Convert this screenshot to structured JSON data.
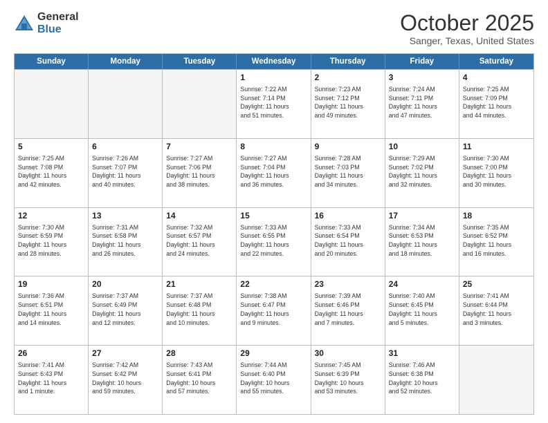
{
  "logo": {
    "general": "General",
    "blue": "Blue"
  },
  "header": {
    "month": "October 2025",
    "location": "Sanger, Texas, United States"
  },
  "days_of_week": [
    "Sunday",
    "Monday",
    "Tuesday",
    "Wednesday",
    "Thursday",
    "Friday",
    "Saturday"
  ],
  "weeks": [
    [
      {
        "day": "",
        "info": ""
      },
      {
        "day": "",
        "info": ""
      },
      {
        "day": "",
        "info": ""
      },
      {
        "day": "1",
        "info": "Sunrise: 7:22 AM\nSunset: 7:14 PM\nDaylight: 11 hours\nand 51 minutes."
      },
      {
        "day": "2",
        "info": "Sunrise: 7:23 AM\nSunset: 7:12 PM\nDaylight: 11 hours\nand 49 minutes."
      },
      {
        "day": "3",
        "info": "Sunrise: 7:24 AM\nSunset: 7:11 PM\nDaylight: 11 hours\nand 47 minutes."
      },
      {
        "day": "4",
        "info": "Sunrise: 7:25 AM\nSunset: 7:09 PM\nDaylight: 11 hours\nand 44 minutes."
      }
    ],
    [
      {
        "day": "5",
        "info": "Sunrise: 7:25 AM\nSunset: 7:08 PM\nDaylight: 11 hours\nand 42 minutes."
      },
      {
        "day": "6",
        "info": "Sunrise: 7:26 AM\nSunset: 7:07 PM\nDaylight: 11 hours\nand 40 minutes."
      },
      {
        "day": "7",
        "info": "Sunrise: 7:27 AM\nSunset: 7:06 PM\nDaylight: 11 hours\nand 38 minutes."
      },
      {
        "day": "8",
        "info": "Sunrise: 7:27 AM\nSunset: 7:04 PM\nDaylight: 11 hours\nand 36 minutes."
      },
      {
        "day": "9",
        "info": "Sunrise: 7:28 AM\nSunset: 7:03 PM\nDaylight: 11 hours\nand 34 minutes."
      },
      {
        "day": "10",
        "info": "Sunrise: 7:29 AM\nSunset: 7:02 PM\nDaylight: 11 hours\nand 32 minutes."
      },
      {
        "day": "11",
        "info": "Sunrise: 7:30 AM\nSunset: 7:00 PM\nDaylight: 11 hours\nand 30 minutes."
      }
    ],
    [
      {
        "day": "12",
        "info": "Sunrise: 7:30 AM\nSunset: 6:59 PM\nDaylight: 11 hours\nand 28 minutes."
      },
      {
        "day": "13",
        "info": "Sunrise: 7:31 AM\nSunset: 6:58 PM\nDaylight: 11 hours\nand 26 minutes."
      },
      {
        "day": "14",
        "info": "Sunrise: 7:32 AM\nSunset: 6:57 PM\nDaylight: 11 hours\nand 24 minutes."
      },
      {
        "day": "15",
        "info": "Sunrise: 7:33 AM\nSunset: 6:55 PM\nDaylight: 11 hours\nand 22 minutes."
      },
      {
        "day": "16",
        "info": "Sunrise: 7:33 AM\nSunset: 6:54 PM\nDaylight: 11 hours\nand 20 minutes."
      },
      {
        "day": "17",
        "info": "Sunrise: 7:34 AM\nSunset: 6:53 PM\nDaylight: 11 hours\nand 18 minutes."
      },
      {
        "day": "18",
        "info": "Sunrise: 7:35 AM\nSunset: 6:52 PM\nDaylight: 11 hours\nand 16 minutes."
      }
    ],
    [
      {
        "day": "19",
        "info": "Sunrise: 7:36 AM\nSunset: 6:51 PM\nDaylight: 11 hours\nand 14 minutes."
      },
      {
        "day": "20",
        "info": "Sunrise: 7:37 AM\nSunset: 6:49 PM\nDaylight: 11 hours\nand 12 minutes."
      },
      {
        "day": "21",
        "info": "Sunrise: 7:37 AM\nSunset: 6:48 PM\nDaylight: 11 hours\nand 10 minutes."
      },
      {
        "day": "22",
        "info": "Sunrise: 7:38 AM\nSunset: 6:47 PM\nDaylight: 11 hours\nand 9 minutes."
      },
      {
        "day": "23",
        "info": "Sunrise: 7:39 AM\nSunset: 6:46 PM\nDaylight: 11 hours\nand 7 minutes."
      },
      {
        "day": "24",
        "info": "Sunrise: 7:40 AM\nSunset: 6:45 PM\nDaylight: 11 hours\nand 5 minutes."
      },
      {
        "day": "25",
        "info": "Sunrise: 7:41 AM\nSunset: 6:44 PM\nDaylight: 11 hours\nand 3 minutes."
      }
    ],
    [
      {
        "day": "26",
        "info": "Sunrise: 7:41 AM\nSunset: 6:43 PM\nDaylight: 11 hours\nand 1 minute."
      },
      {
        "day": "27",
        "info": "Sunrise: 7:42 AM\nSunset: 6:42 PM\nDaylight: 10 hours\nand 59 minutes."
      },
      {
        "day": "28",
        "info": "Sunrise: 7:43 AM\nSunset: 6:41 PM\nDaylight: 10 hours\nand 57 minutes."
      },
      {
        "day": "29",
        "info": "Sunrise: 7:44 AM\nSunset: 6:40 PM\nDaylight: 10 hours\nand 55 minutes."
      },
      {
        "day": "30",
        "info": "Sunrise: 7:45 AM\nSunset: 6:39 PM\nDaylight: 10 hours\nand 53 minutes."
      },
      {
        "day": "31",
        "info": "Sunrise: 7:46 AM\nSunset: 6:38 PM\nDaylight: 10 hours\nand 52 minutes."
      },
      {
        "day": "",
        "info": ""
      }
    ]
  ]
}
